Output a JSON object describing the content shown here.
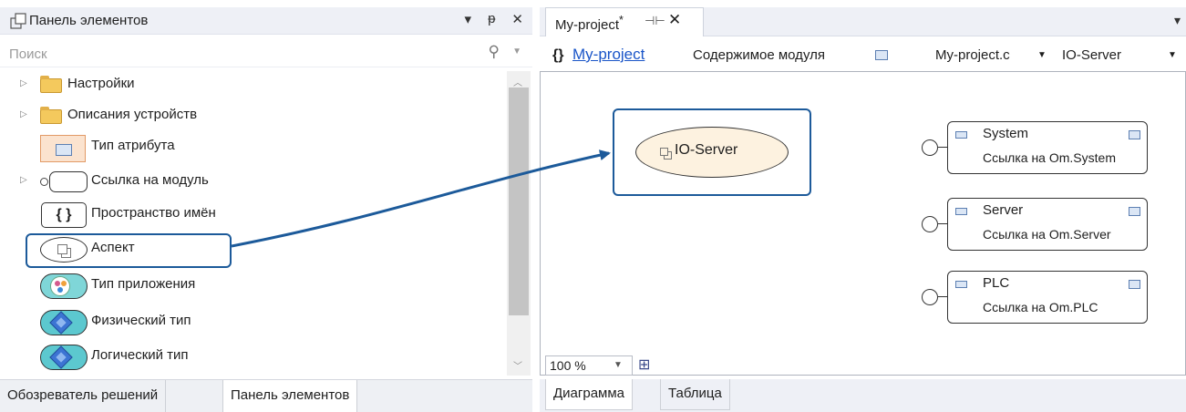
{
  "toolbox": {
    "title": "Панель элементов",
    "title_buttons": [
      "▾",
      "ᵽ",
      "✕"
    ],
    "search_placeholder": "Поиск",
    "items": [
      {
        "label": "Настройки",
        "icon": "folder-icon",
        "expandable": true
      },
      {
        "label": "Описания устройств",
        "icon": "folder-icon",
        "expandable": true
      },
      {
        "label": "Тип атрибута",
        "icon": "attribute-type-icon",
        "expandable": false
      },
      {
        "label": "Ссылка на модуль",
        "icon": "module-reference-icon",
        "expandable": true
      },
      {
        "label": "Пространство имён",
        "icon": "namespace-icon",
        "expandable": false,
        "glyph": "{ }"
      },
      {
        "label": "Аспект",
        "icon": "aspect-icon",
        "expandable": false,
        "highlighted": true
      },
      {
        "label": "Тип приложения",
        "icon": "application-type-icon",
        "expandable": false
      },
      {
        "label": "Физический тип",
        "icon": "physical-type-icon",
        "expandable": false
      },
      {
        "label": "Логический тип",
        "icon": "logical-type-icon",
        "expandable": false
      }
    ]
  },
  "bottom_tabs": {
    "solution_explorer": "Обозреватель решений",
    "toolbox": "Панель элементов"
  },
  "document": {
    "tab_title": "My-project",
    "tab_modified": "*",
    "menu_glyph": "▾",
    "nav": {
      "brace": "{}",
      "link": "My-project",
      "content_label": "Содержимое модуля",
      "dropdown1": "My-project.c",
      "dropdown2": "IO-Server"
    },
    "diagram": {
      "aspect_node": "IO-Server",
      "references": [
        {
          "name": "System",
          "subtitle": "Ссылка на Om.System"
        },
        {
          "name": "Server",
          "subtitle": "Ссылка на Om.Server"
        },
        {
          "name": "PLC",
          "subtitle": "Ссылка на Om.PLC"
        }
      ]
    },
    "zoom": "100 %",
    "bottom_tabs": {
      "diagram": "Диаграмма",
      "table": "Таблица"
    }
  },
  "colors": {
    "highlight_border": "#1c5a9a",
    "link": "#1a55c8",
    "aspect_fill": "#fdf2e0"
  }
}
